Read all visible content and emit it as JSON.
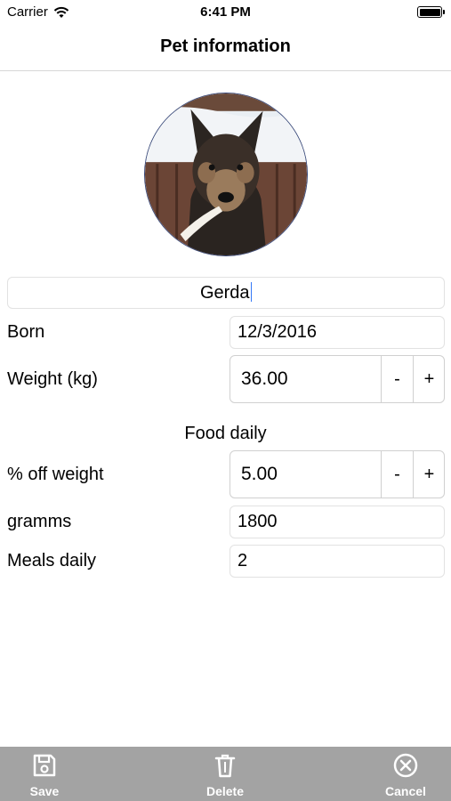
{
  "status_bar": {
    "carrier": "Carrier",
    "time": "6:41 PM"
  },
  "nav": {
    "title": "Pet information"
  },
  "pet": {
    "photo_icon": "dog-photo",
    "name": "Gerda"
  },
  "fields": {
    "born_label": "Born",
    "born_value": "12/3/2016",
    "weight_label": "Weight (kg)",
    "weight_value": "36.00",
    "food_section_title": "Food daily",
    "percent_label": "% off weight",
    "percent_value": "5.00",
    "gramms_label": "gramms",
    "gramms_value": "1800",
    "meals_label": "Meals daily",
    "meals_value": "2"
  },
  "stepper": {
    "minus": "-",
    "plus": "+"
  },
  "toolbar": {
    "save_label": "Save",
    "save_icon": "floppy-disk-icon",
    "delete_label": "Delete",
    "delete_icon": "trash-icon",
    "cancel_label": "Cancel",
    "cancel_icon": "close-circle-icon"
  },
  "colors": {
    "toolbar_bg": "#a3a3a3",
    "caret": "#3478f6"
  }
}
